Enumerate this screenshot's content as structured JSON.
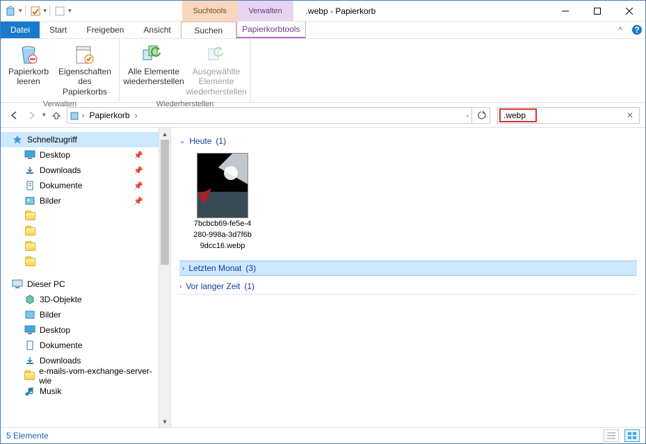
{
  "window": {
    "title": ".webp - Papierkorb"
  },
  "ctx": {
    "search_group": "Suchtools",
    "search_tab": "Suchen",
    "manage_group": "Verwalten",
    "manage_tab": "Papierkorbtools"
  },
  "tabs": {
    "file": "Datei",
    "start": "Start",
    "share": "Freigeben",
    "view": "Ansicht"
  },
  "ribbon": {
    "g1": {
      "label": "Verwalten",
      "b1": {
        "l1": "Papierkorb",
        "l2": "leeren"
      },
      "b2": {
        "l1": "Eigenschaften",
        "l2": "des Papierkorbs"
      }
    },
    "g2": {
      "label": "Wiederherstellen",
      "b1": {
        "l1": "Alle Elemente",
        "l2": "wiederherstellen"
      },
      "b2": {
        "l1": "Ausgewählte Elemente",
        "l2": "wiederherstellen"
      }
    }
  },
  "breadcrumb": {
    "root": "Papierkorb"
  },
  "search": {
    "value": ".webp"
  },
  "sidebar": {
    "quick": "Schnellzugriff",
    "items": [
      "Desktop",
      "Downloads",
      "Dokumente",
      "Bilder"
    ],
    "thispc": "Dieser PC",
    "pcitems": [
      "3D-Objekte",
      "Bilder",
      "Desktop",
      "Dokumente",
      "Downloads",
      "e-mails-vom-exchange-server-wie",
      "Musik"
    ]
  },
  "groups": {
    "g0": {
      "label": "Heute",
      "count": "(1)"
    },
    "g1": {
      "label": "Letzten Monat",
      "count": "(3)"
    },
    "g2": {
      "label": "Vor langer Zeit",
      "count": "(1)"
    }
  },
  "file0": {
    "l1": "7bcbcb69-fe5e-4",
    "l2": "280-998a-3d7f6b",
    "l3": "9dcc16.webp"
  },
  "status": {
    "count": "5 Elemente"
  }
}
